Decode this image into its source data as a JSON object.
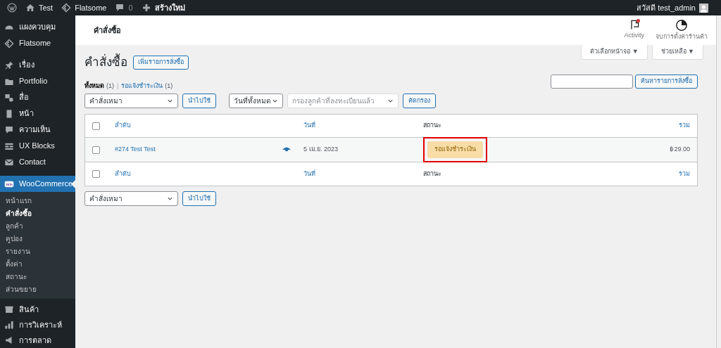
{
  "admin_bar": {
    "items": [
      {
        "kind": "wp"
      },
      {
        "kind": "home",
        "label": "Test"
      },
      {
        "kind": "flatsome",
        "label": "Flatsome"
      },
      {
        "kind": "comments",
        "label": "0"
      },
      {
        "kind": "new",
        "label": "สร้างใหม่"
      }
    ],
    "greeting": "สวัสดี test_admin"
  },
  "sidebar": {
    "items": [
      {
        "label": "แผงควบคุม",
        "selected": false
      },
      {
        "label": "Flatsome",
        "selected": false
      },
      {
        "label": "เรื่อง",
        "selected": false
      },
      {
        "label": "Portfolio",
        "selected": false
      },
      {
        "label": "สื่อ",
        "selected": false
      },
      {
        "label": "หน้า",
        "selected": false
      },
      {
        "label": "ความเห็น",
        "selected": false
      },
      {
        "label": "UX Blocks",
        "selected": false
      },
      {
        "label": "Contact",
        "selected": false
      },
      {
        "label": "WooCommerce",
        "selected": true,
        "children": [
          {
            "label": "หน้าแรก",
            "selected": false
          },
          {
            "label": "คำสั่งซื้อ",
            "selected": true
          },
          {
            "label": "ลูกค้า",
            "selected": false
          },
          {
            "label": "คูปอง",
            "selected": false
          },
          {
            "label": "รายงาน",
            "selected": false
          },
          {
            "label": "ตั้งค่า",
            "selected": false
          },
          {
            "label": "สถานะ",
            "selected": false
          },
          {
            "label": "ส่วนขยาย",
            "selected": false
          }
        ]
      },
      {
        "label": "สินค้า",
        "selected": false
      },
      {
        "label": "การวิเคราะห์",
        "selected": false
      },
      {
        "label": "การตลาด",
        "selected": false
      }
    ]
  },
  "header": {
    "title": "คำสั่งซื้อ",
    "actions": [
      {
        "label": "Activity",
        "badge": true
      },
      {
        "label": "จบการตั้งค่าร้านค้า",
        "badge": false
      }
    ]
  },
  "screen_tabs": [
    "ตัวเลือกหน้าจอ ▼",
    "ช่วยเหลือ ▼"
  ],
  "page_title": "คำสั่งซื้อ",
  "add_button": "เพิ่มรายการสั่งซื้อ",
  "views_separator": "|",
  "views": [
    {
      "label": "ทั้งหมด",
      "count": "(1)",
      "selected": true
    },
    {
      "label": "รอแจ้งชำระเงิน",
      "count": "(1)",
      "selected": false
    }
  ],
  "search_button": "ค้นหารายการสั่งซื้อ",
  "filters": {
    "bulk_action": "คำสั่งเหมา",
    "apply": "นำไปใช้",
    "date": "วันที่ทั้งหมด",
    "customer_placeholder": "กรองลูกค้าที่ลงทะเบียนแล้ว",
    "filter": "คัดกรอง"
  },
  "table": {
    "columns": [
      "ลำดับ",
      "วันที่",
      "สถานะ",
      "รวม"
    ],
    "header_checked": false,
    "footer_checked": false,
    "rows": [
      {
        "order": "#274 Test Test",
        "date": "5 เม.ย. 2023",
        "status": "รอแจ้งชำระเงิน",
        "total": "฿29.00",
        "checked": false,
        "highlighted": true
      }
    ],
    "footer_columns": [
      "ลำดับ",
      "วันที่",
      "สถานะ",
      "รวม"
    ]
  },
  "bottom": {
    "bulk_action": "คำสั่งเหมา",
    "apply": "นำไปใช้"
  }
}
